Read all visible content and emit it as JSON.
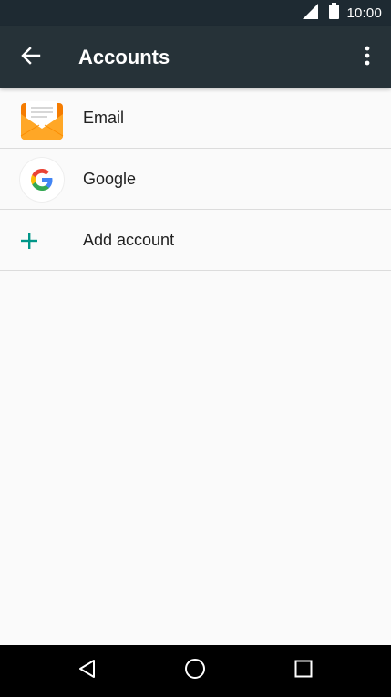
{
  "status_bar": {
    "time": "10:00",
    "icons": [
      "signal-icon",
      "battery-icon"
    ]
  },
  "toolbar": {
    "title": "Accounts",
    "back_icon": "arrow-back-icon",
    "menu_icon": "more-vert-icon"
  },
  "accounts": {
    "items": [
      {
        "label": "Email",
        "icon": "email-app-icon"
      },
      {
        "label": "Google",
        "icon": "google-icon"
      },
      {
        "label": "Add account",
        "icon": "plus-icon"
      }
    ]
  },
  "nav_bar": {
    "icons": [
      "nav-back-icon",
      "nav-home-icon",
      "nav-recents-icon"
    ]
  },
  "colors": {
    "toolbar": "#263238",
    "status_bar": "#1e2a32",
    "background": "#fafafa",
    "accent": "#009688",
    "divider": "#dcdcdc"
  }
}
